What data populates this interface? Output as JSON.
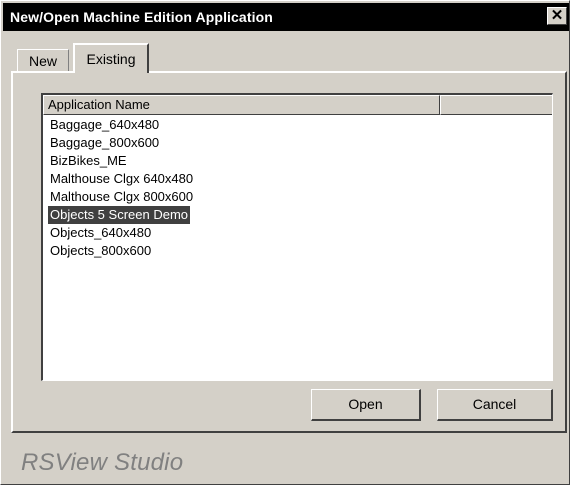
{
  "window": {
    "title": "New/Open Machine Edition Application",
    "close_label": "✕"
  },
  "tabs": [
    {
      "label": "New",
      "selected": false
    },
    {
      "label": "Existing",
      "selected": true
    }
  ],
  "list": {
    "columns": [
      {
        "label": "Application Name"
      },
      {
        "label": ""
      }
    ],
    "rows": [
      {
        "name": "Baggage_640x480",
        "selected": false
      },
      {
        "name": "Baggage_800x600",
        "selected": false
      },
      {
        "name": "BizBikes_ME",
        "selected": false
      },
      {
        "name": "Malthouse Clgx 640x480",
        "selected": false
      },
      {
        "name": "Malthouse Clgx 800x600",
        "selected": false
      },
      {
        "name": "Objects 5 Screen Demo",
        "selected": true
      },
      {
        "name": "Objects_640x480",
        "selected": false
      },
      {
        "name": "Objects_800x600",
        "selected": false
      }
    ]
  },
  "buttons": {
    "open_label": "Open",
    "cancel_label": "Cancel"
  },
  "brand": {
    "label": "RSView Studio"
  },
  "colors": {
    "face": "#d4d0c8",
    "titlebar": "#000000",
    "selection": "#404040",
    "brand_text": "#808080"
  }
}
